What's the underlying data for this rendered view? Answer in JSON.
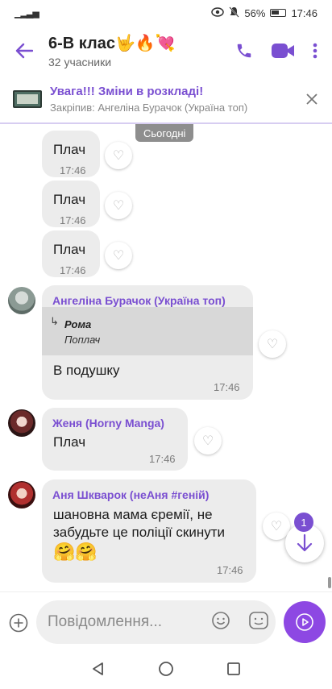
{
  "status": {
    "battery": "56%",
    "time": "17:46"
  },
  "header": {
    "back": "←",
    "title": "6-В клас🤟🔥💘",
    "members": "32 учасники"
  },
  "pinned": {
    "title": "Увага!!! Зміни в розкладі!",
    "subtitle": "Закріпив: Ангеліна Бурачок (Україна топ)",
    "close": "✕"
  },
  "chat": {
    "day_label": "Сьогодні",
    "own_messages": [
      {
        "text": "Плач",
        "time": "17:46"
      },
      {
        "text": "Плач",
        "time": "17:46"
      },
      {
        "text": "Плач",
        "time": "17:46"
      }
    ],
    "angelina": {
      "sender": "Ангеліна Бурачок (Україна топ)",
      "quote_name": "Рома",
      "quote_text": "Поплач",
      "text": "В подушку",
      "time": "17:46"
    },
    "zhenya": {
      "sender": "Женя (Horny Manga)",
      "text": "Плач",
      "time": "17:46"
    },
    "anya": {
      "sender": "Аня Шкварок (неАня #геній)",
      "text": "шановна мама єремії, не забудьте це поліції скинути",
      "emoji": "🤗🤗",
      "time": "17:46"
    },
    "unread_count": "1"
  },
  "composer": {
    "placeholder": "Повідомлення..."
  },
  "colors": {
    "accent": "#7a4fd1",
    "bubble": "#ececec",
    "send": "#8d48e3"
  }
}
